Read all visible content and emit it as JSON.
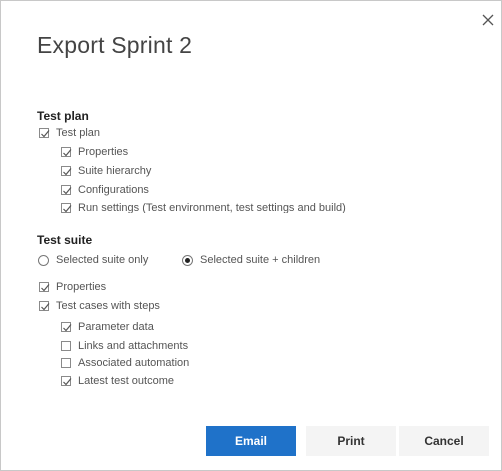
{
  "dialog": {
    "title": "Export Sprint 2"
  },
  "test_plan": {
    "title": "Test plan",
    "items": [
      {
        "label": "Test plan",
        "checked": true
      },
      {
        "label": "Properties",
        "checked": true
      },
      {
        "label": "Suite hierarchy",
        "checked": true
      },
      {
        "label": "Configurations",
        "checked": true
      },
      {
        "label": "Run settings (Test environment, test settings and build)",
        "checked": true
      }
    ]
  },
  "test_suite": {
    "title": "Test suite",
    "radio_selected_only": "Selected suite only",
    "radio_selected_children": "Selected suite + children",
    "selected_option": "Selected suite + children",
    "items": [
      {
        "label": "Properties",
        "checked": true
      },
      {
        "label": "Test cases with steps",
        "checked": true
      },
      {
        "label": "Parameter data",
        "checked": true
      },
      {
        "label": "Links and attachments",
        "checked": false
      },
      {
        "label": "Associated automation",
        "checked": false
      },
      {
        "label": "Latest test outcome",
        "checked": true
      }
    ]
  },
  "buttons": {
    "email": "Email",
    "print": "Print",
    "cancel": "Cancel"
  },
  "colors": {
    "primary": "#1f72c9",
    "check": "#3a7a3a"
  }
}
